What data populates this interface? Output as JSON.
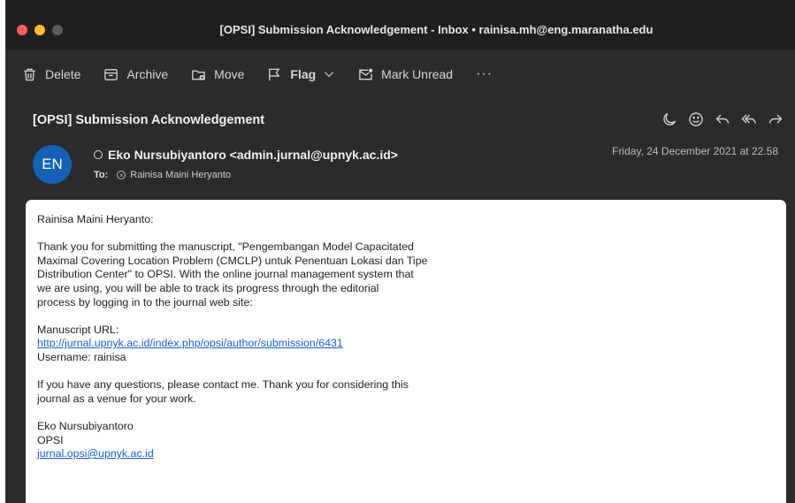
{
  "window": {
    "title": "[OPSI] Submission Acknowledgement - Inbox • rainisa.mh@eng.maranatha.edu"
  },
  "toolbar": {
    "delete_label": "Delete",
    "archive_label": "Archive",
    "move_label": "Move",
    "flag_label": "Flag",
    "mark_unread_label": "Mark Unread",
    "more_label": "···"
  },
  "message": {
    "subject": "[OPSI] Submission Acknowledgement",
    "avatar_initials": "EN",
    "sender": "Eko Nursubiyantoro <admin.jurnal@upnyk.ac.id>",
    "to_label": "To:",
    "recipient": "Rainisa Maini Heryanto",
    "date": "Friday, 24 December 2021 at 22.58"
  },
  "body": {
    "greeting": "Rainisa Maini Heryanto:",
    "paragraph1": [
      "Thank you for submitting the manuscript, \"Pengembangan Model Capacitated",
      "Maximal Covering Location Problem (CMCLP) untuk Penentuan Lokasi dan Tipe",
      "Distribution Center\" to OPSI. With the online journal management system that",
      "we are using, you will be able to track its progress through the editorial",
      "process by logging in to the journal web site:"
    ],
    "manuscript_url_label": "Manuscript URL:",
    "manuscript_url": "http://jurnal.upnyk.ac.id/index.php/opsi/author/submission/6431",
    "username_line": "Username: rainisa",
    "paragraph2": [
      "If you have any questions, please contact me. Thank you for considering this",
      "journal as a venue for your work."
    ],
    "signature_name": "Eko Nursubiyantoro",
    "signature_org": "OPSI",
    "signature_email": "jurnal.opsi@upnyk.ac.id"
  },
  "colors": {
    "avatar": "#1561b8",
    "link": "#1a5fcf",
    "close": "#fe5f57",
    "minimize": "#febc2e"
  },
  "icons": {
    "delete": "trash-icon",
    "archive": "archive-box-icon",
    "move": "folder-move-icon",
    "flag": "flag-icon",
    "mark_unread": "envelope-dot-icon",
    "reply": "reply-icon",
    "reply_all": "reply-all-icon",
    "forward": "forward-icon"
  }
}
